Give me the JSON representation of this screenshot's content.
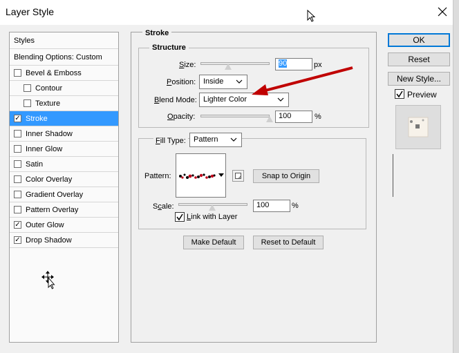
{
  "window": {
    "title": "Layer Style"
  },
  "sidebar": {
    "styles_header": "Styles",
    "blending_header": "Blending Options: Custom",
    "items": [
      {
        "label": "Bevel & Emboss",
        "checked": false,
        "indent": false
      },
      {
        "label": "Contour",
        "checked": false,
        "indent": true
      },
      {
        "label": "Texture",
        "checked": false,
        "indent": true
      },
      {
        "label": "Stroke",
        "checked": true,
        "indent": false,
        "selected": true
      },
      {
        "label": "Inner Shadow",
        "checked": false,
        "indent": false
      },
      {
        "label": "Inner Glow",
        "checked": false,
        "indent": false
      },
      {
        "label": "Satin",
        "checked": false,
        "indent": false
      },
      {
        "label": "Color Overlay",
        "checked": false,
        "indent": false
      },
      {
        "label": "Gradient Overlay",
        "checked": false,
        "indent": false
      },
      {
        "label": "Pattern Overlay",
        "checked": false,
        "indent": false
      },
      {
        "label": "Outer Glow",
        "checked": true,
        "indent": false
      },
      {
        "label": "Drop Shadow",
        "checked": true,
        "indent": false
      }
    ]
  },
  "stroke": {
    "section_title": "Stroke",
    "structure_title": "Structure",
    "size": {
      "label_u": "S",
      "label_rest": "ize:",
      "value": "90",
      "unit": "px"
    },
    "position": {
      "label_u": "P",
      "label_rest": "osition:",
      "value": "Inside"
    },
    "blend_mode": {
      "label_u": "B",
      "label_rest": "lend Mode:",
      "value": "Lighter Color"
    },
    "opacity": {
      "label_u": "O",
      "label_rest": "pacity:",
      "value": "100",
      "unit": "%"
    },
    "fill_type": {
      "label_u": "F",
      "label_rest": "ill Type:",
      "value": "Pattern"
    },
    "pattern": {
      "label": "Pattern:",
      "snap_button": "Snap to Origin"
    },
    "scale": {
      "label_u": "c",
      "label_pre": "S",
      "label_rest": "ale:",
      "value": "100",
      "unit": "%"
    },
    "link": {
      "label_u": "L",
      "label_rest": "ink with Layer",
      "checked": true
    },
    "make_default": "Make Default",
    "reset_default": "Reset to Default"
  },
  "actions": {
    "ok": "OK",
    "reset": "Reset",
    "new_style": "New Style...",
    "preview_label": "Preview",
    "preview_checked": true
  },
  "colors": {
    "selection": "#3399ff",
    "arrow": "#c00000",
    "primary_border": "#0078d7"
  }
}
